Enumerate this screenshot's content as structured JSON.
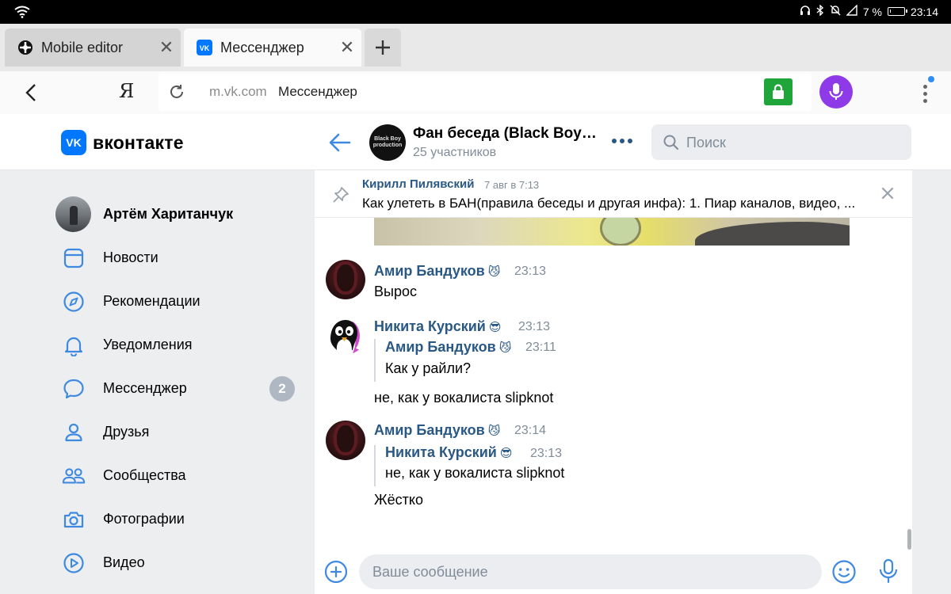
{
  "status_bar": {
    "battery": "7 %",
    "time": "23:14",
    "battery_level": 0.07
  },
  "browser": {
    "tabs": [
      {
        "label": "Mobile editor",
        "active": false
      },
      {
        "label": "Мессенджер",
        "active": true
      }
    ],
    "address": {
      "domain": "m.vk.com",
      "title": "Мессенджер"
    },
    "search_engine_glyph": "Я",
    "colors": {
      "secure_lock": "#1fa53a",
      "voice": "#8f3ae8",
      "notification": "#2f8df5"
    }
  },
  "vk": {
    "logo_text": "вконтакте",
    "logo_mark": "VK",
    "brand_color": "#0077ff",
    "conversation": {
      "title": "Фан беседа (Black Boy production)",
      "subtitle": "25 участников",
      "avatar_text": "Black Boy production"
    },
    "search_placeholder": "Поиск"
  },
  "menu": {
    "profile_name": "Артём Хаританчук",
    "items": [
      {
        "label": "Новости",
        "icon": "news-icon"
      },
      {
        "label": "Рекомендации",
        "icon": "compass-icon"
      },
      {
        "label": "Уведомления",
        "icon": "bell-icon"
      },
      {
        "label": "Мессенджер",
        "icon": "chat-bubble-icon",
        "badge": "2"
      },
      {
        "label": "Друзья",
        "icon": "person-icon"
      },
      {
        "label": "Сообщества",
        "icon": "group-icon"
      },
      {
        "label": "Фотографии",
        "icon": "camera-icon"
      },
      {
        "label": "Видео",
        "icon": "play-icon"
      }
    ]
  },
  "chat": {
    "pinned": {
      "author": "Кирилл Пилявский",
      "date": "7 авг в 7:13",
      "text": "Как улететь в БАН(правила беседы и другая инфа): 1. Пиар каналов, видео, ..."
    },
    "messages": [
      {
        "author": "Амир Бандуков",
        "emoji": "😼",
        "time": "23:13",
        "text": "Вырос"
      },
      {
        "author": "Никита Курский",
        "emoji": "😎",
        "time": "23:13",
        "quote": {
          "author": "Амир Бандуков",
          "emoji": "😼",
          "time": "23:11",
          "text": "Как у райли?"
        },
        "text": "не, как у вокалиста slipknot"
      },
      {
        "author": "Амир Бандуков",
        "emoji": "😼",
        "time": "23:14",
        "quote": {
          "author": "Никита Курский",
          "emoji": "😎",
          "time": "23:13",
          "text": "не, как у вокалиста slipknot"
        },
        "text": "Жёстко"
      }
    ],
    "composer_placeholder": "Ваше сообщение"
  }
}
